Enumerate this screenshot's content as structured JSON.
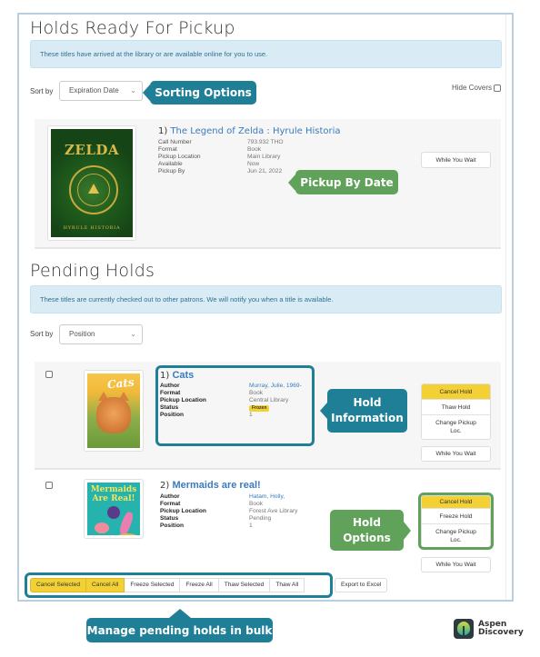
{
  "ready": {
    "title": "Holds Ready For Pickup",
    "info": "These titles have arrived at the library or are available online for you to use.",
    "sort_label": "Sort by",
    "sort_value": "Expiration Date",
    "hide_covers": "Hide Covers",
    "items": [
      {
        "index": "1)",
        "title": "The Legend of Zelda : Hyrule Historia",
        "cover_title": "ZELDA",
        "cover_subtitle": "HYRULE HISTORIA",
        "fields": [
          {
            "label": "Call Number",
            "value": "793.932 THO"
          },
          {
            "label": "Format",
            "value": "Book"
          },
          {
            "label": "Pickup Location",
            "value": "Main Library"
          },
          {
            "label": "Available",
            "value": "Now"
          },
          {
            "label": "Pickup By",
            "value": "Jun 21, 2022"
          }
        ],
        "while_you_wait": "While You Wait"
      }
    ]
  },
  "pending": {
    "title": "Pending Holds",
    "info": "These titles are currently checked out to other patrons. We will notify you when a title is available.",
    "sort_label": "Sort by",
    "sort_value": "Position",
    "items": [
      {
        "index": "1)",
        "title": "Cats",
        "cover_title": "Cats",
        "fields": [
          {
            "label": "Author",
            "value": "Murray, Julie, 1969-"
          },
          {
            "label": "Format",
            "value": "Book"
          },
          {
            "label": "Pickup Location",
            "value": "Central Library"
          },
          {
            "label": "Status",
            "value": "Frozen"
          },
          {
            "label": "Position",
            "value": "1"
          }
        ],
        "actions": [
          "Cancel Hold",
          "Thaw Hold",
          "Change Pickup Loc."
        ],
        "while_you_wait": "While You Wait"
      },
      {
        "index": "2)",
        "title": "Mermaids are real!",
        "cover_title": "Mermaids Are Real!",
        "fields": [
          {
            "label": "Author",
            "value": "Hatam, Holly,"
          },
          {
            "label": "Format",
            "value": "Book"
          },
          {
            "label": "Pickup Location",
            "value": "Forest Ave Library"
          },
          {
            "label": "Status",
            "value": "Pending"
          },
          {
            "label": "Position",
            "value": "1"
          }
        ],
        "actions": [
          "Cancel Hold",
          "Freeze Hold",
          "Change Pickup Loc."
        ],
        "while_you_wait": "While You Wait"
      }
    ],
    "bulk_actions": [
      "Cancel Selected",
      "Cancel All",
      "Freeze Selected",
      "Freeze All",
      "Thaw Selected",
      "Thaw All"
    ],
    "export": "Export to Excel"
  },
  "annotations": {
    "sorting": "Sorting Options",
    "pickup_by": "Pickup By Date",
    "hold_info": "Hold Information",
    "hold_options": "Hold Options",
    "bulk": "Manage pending holds in bulk"
  },
  "logo": {
    "line1": "Aspen",
    "line2": "Discovery"
  },
  "colors": {
    "teal": "#1f7f96",
    "green": "#61a25a",
    "warning": "#f3d135",
    "link": "#3a7bbf",
    "info_bg": "#d9ecf5"
  }
}
